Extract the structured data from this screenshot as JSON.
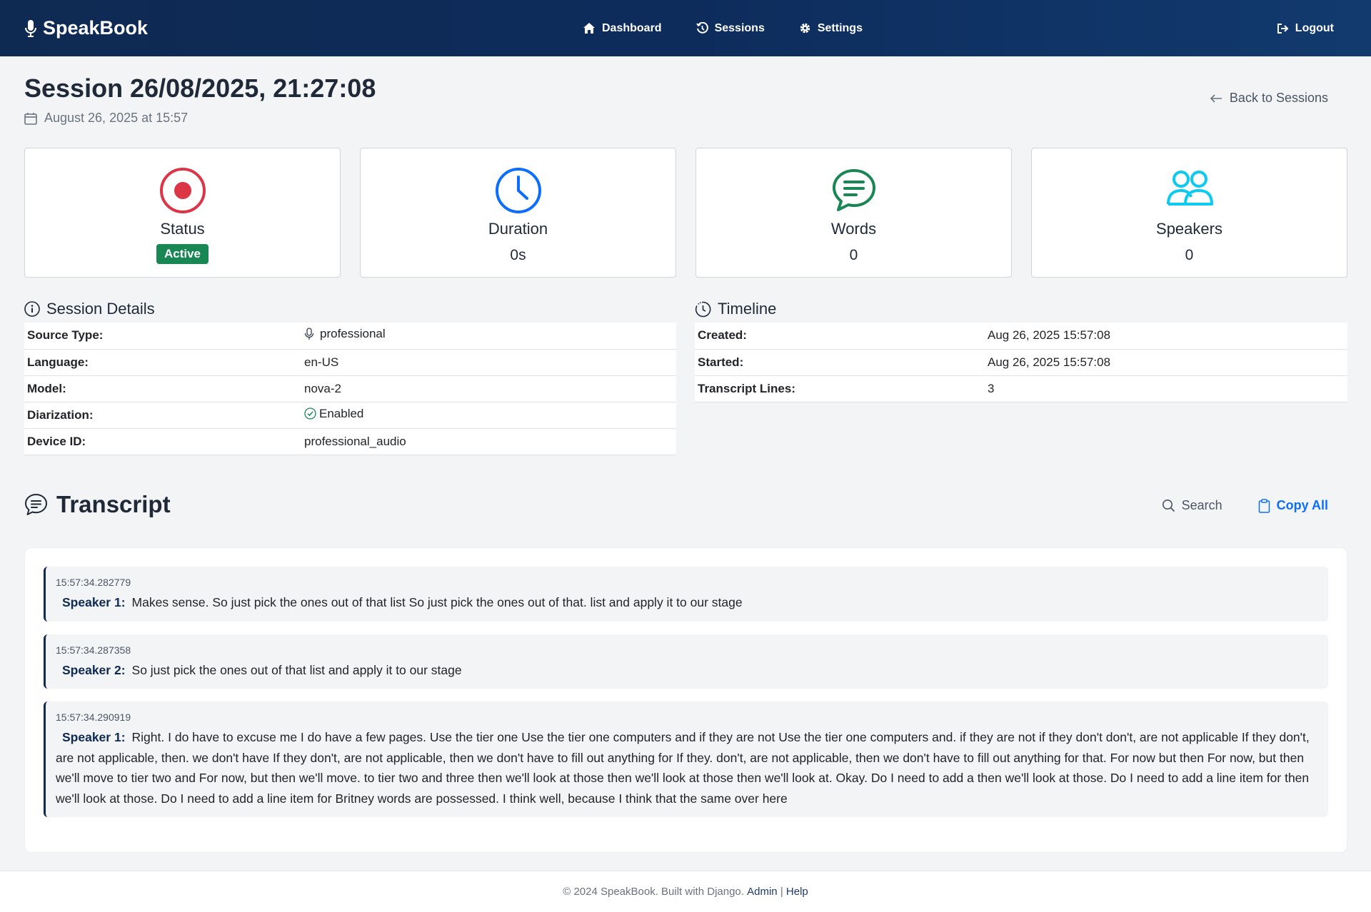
{
  "nav": {
    "brand": "SpeakBook",
    "items": [
      {
        "label": "Dashboard"
      },
      {
        "label": "Sessions"
      },
      {
        "label": "Settings"
      }
    ],
    "logout": "Logout"
  },
  "page": {
    "title": "Session 26/08/2025, 21:27:08",
    "subtitle": "August 26, 2025 at 15:57",
    "back": "Back to Sessions"
  },
  "stats": {
    "status": {
      "label": "Status",
      "value": "Active"
    },
    "duration": {
      "label": "Duration",
      "value": "0s"
    },
    "words": {
      "label": "Words",
      "value": "0"
    },
    "speakers": {
      "label": "Speakers",
      "value": "0"
    }
  },
  "colors": {
    "status": "#dc3545",
    "duration": "#0d6efd",
    "words": "#198754",
    "speakers": "#0dcaf0"
  },
  "details": {
    "title": "Session Details",
    "rows": [
      {
        "k": "Source Type:",
        "v": "professional"
      },
      {
        "k": "Language:",
        "v": "en-US"
      },
      {
        "k": "Model:",
        "v": "nova-2"
      },
      {
        "k": "Diarization:",
        "v": "Enabled"
      },
      {
        "k": "Device ID:",
        "v": "professional_audio"
      }
    ]
  },
  "timeline": {
    "title": "Timeline",
    "rows": [
      {
        "k": "Created:",
        "v": "Aug 26, 2025 15:57:08"
      },
      {
        "k": "Started:",
        "v": "Aug 26, 2025 15:57:08"
      },
      {
        "k": "Transcript Lines:",
        "v": "3"
      }
    ]
  },
  "transcript": {
    "title": "Transcript",
    "search": "Search",
    "copy": "Copy All",
    "entries": [
      {
        "ts": "15:57:34.282779",
        "speaker": "Speaker 1:",
        "text": "Makes sense. So just pick the ones out of that list So just pick the ones out of that. list and apply it to our stage"
      },
      {
        "ts": "15:57:34.287358",
        "speaker": "Speaker 2:",
        "text": "So just pick the ones out of that list and apply it to our stage"
      },
      {
        "ts": "15:57:34.290919",
        "speaker": "Speaker 1:",
        "text": "Right. I do have to excuse me I do have a few pages. Use the tier one Use the tier one computers and if they are not Use the tier one computers and. if they are not if they don't don't, are not applicable If they don't, are not applicable, then. we don't have If they don't, are not applicable, then we don't have to fill out anything for If they. don't, are not applicable, then we don't have to fill out anything for that. For now but then For now, but then we'll move to tier two and For now, but then we'll move. to tier two and three then we'll look at those then we'll look at those then we'll look at. Okay. Do I need to add a then we'll look at those. Do I need to add a line item for then we'll look at those. Do I need to add a line item for Britney words are possessed. I think well, because I think that the same over here"
      }
    ]
  },
  "footer": {
    "text": "© 2024 SpeakBook. Built with Django.",
    "admin": "Admin",
    "sep": "|",
    "help": "Help"
  }
}
